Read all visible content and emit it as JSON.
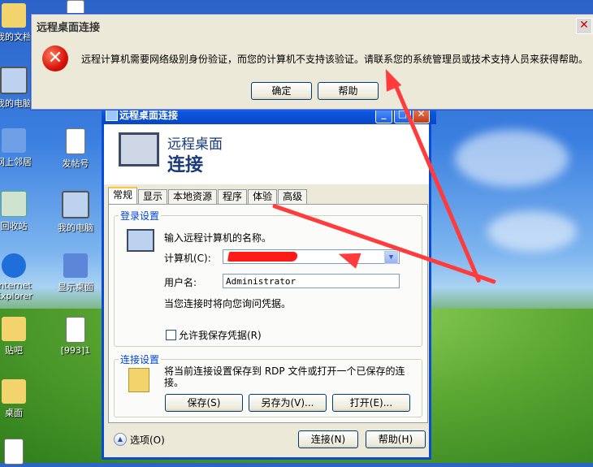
{
  "desktop": [
    {
      "label": "我的文档"
    },
    {
      "label": "我的电脑"
    },
    {
      "label": "网上邻居"
    },
    {
      "label": "发帖号"
    },
    {
      "label": "回收站"
    },
    {
      "label": "我的电脑"
    },
    {
      "label": "Internet"
    },
    {
      "label": "Explorer"
    },
    {
      "label": "显示桌面"
    },
    {
      "label": "贴吧"
    },
    {
      "label": "[993]1"
    },
    {
      "label": "桌面"
    }
  ],
  "error_dialog": {
    "title": "远程桌面连接",
    "close": "✕",
    "message": "远程计算机需要网络级别身份验证，而您的计算机不支持该验证。请联系您的系统管理员或技术支持人员来获得帮助。",
    "ok_label": "确定",
    "help_label": "帮助"
  },
  "rdc": {
    "title": "远程桌面连接",
    "min": "_",
    "max": "□",
    "close": "✕",
    "banner_line1": "远程桌面",
    "banner_line2": "连接",
    "tabs": [
      "常规",
      "显示",
      "本地资源",
      "程序",
      "体验",
      "高级"
    ],
    "login_group": "登录设置",
    "login_prompt": "输入远程计算机的名称。",
    "computer_label": "计算机(C):",
    "user_label": "用户名:",
    "user_value": "Administrator",
    "cred_note": "当您连接时将向您询问凭据。",
    "save_cred_label": "允许我保存凭据(R)",
    "conn_group": "连接设置",
    "conn_desc": "将当前连接设置保存到 RDP 文件或打开一个已保存的连接。",
    "save_btn": "保存(S)",
    "saveas_btn": "另存为(V)...",
    "open_btn": "打开(E)...",
    "options_label": "选项(O)",
    "connect_btn": "连接(N)",
    "help_btn": "帮助(H)"
  }
}
